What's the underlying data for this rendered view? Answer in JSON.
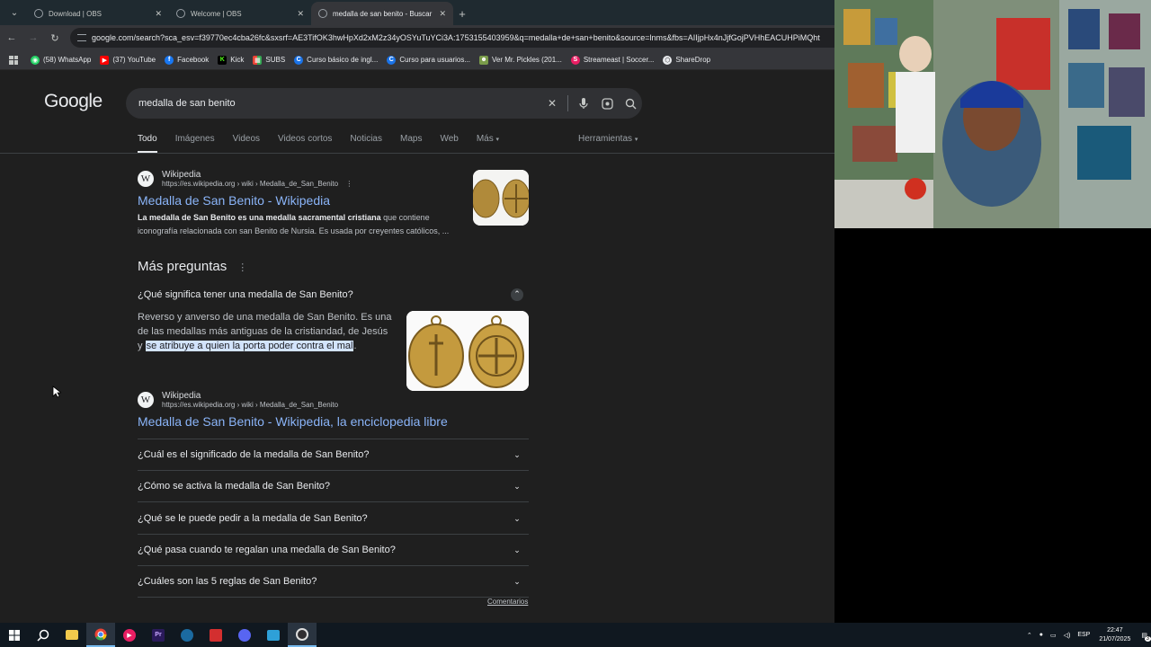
{
  "browser": {
    "tabs": [
      {
        "label": "Download | OBS",
        "active": false
      },
      {
        "label": "Welcome | OBS",
        "active": false
      },
      {
        "label": "medalla de san benito - Buscar",
        "active": true
      }
    ],
    "url": "google.com/search?sca_esv=f39770ec4cba26fc&sxsrf=AE3TifOK3hwHpXd2xM2z34yOSYuTuYCi3A:1753155403959&q=medalla+de+san+benito&source=lnms&fbs=AIIjpHx4nJjfGojPVHhEACUHPiMQht",
    "bookmarks": [
      {
        "label": "(58) WhatsApp",
        "icon": "whatsapp-icon",
        "color": "#25d366"
      },
      {
        "label": "(37) YouTube",
        "icon": "youtube-icon",
        "color": "#ff0000"
      },
      {
        "label": "Facebook",
        "icon": "facebook-icon",
        "color": "#1877f2"
      },
      {
        "label": "Kick",
        "icon": "kick-icon",
        "color": "#53fc18"
      },
      {
        "label": "SUBS",
        "icon": "subs-icon",
        "color": "#e8eaed"
      },
      {
        "label": "Curso básico de ingl...",
        "icon": "course-icon",
        "color": "#1a73e8"
      },
      {
        "label": "Curso para usuarios...",
        "icon": "course-icon",
        "color": "#1a73e8"
      },
      {
        "label": "Ver Mr. Pickles (201...",
        "icon": "pickles-icon",
        "color": "#7a9c4a"
      },
      {
        "label": "Streameast | Soccer...",
        "icon": "streameast-icon",
        "color": "#e91e63"
      },
      {
        "label": "ShareDrop",
        "icon": "sharedrop-icon",
        "color": "#e8eaed"
      }
    ]
  },
  "google": {
    "logo": "Google",
    "query": "medalla de san benito",
    "tabs": [
      "Todo",
      "Imágenes",
      "Videos",
      "Videos cortos",
      "Noticias",
      "Maps",
      "Web",
      "Más"
    ],
    "tools": "Herramientas",
    "result1": {
      "source": "Wikipedia",
      "url": "https://es.wikipedia.org › wiki › Medalla_de_San_Benito",
      "title": "Medalla de San Benito - Wikipedia",
      "snippet_bold": "La medalla de San Benito es una medalla sacramental cristiana",
      "snippet_rest": " que contiene iconografía relacionada con san Benito de Nursia. Es usada por creyentes católicos, ..."
    },
    "paa": {
      "heading": "Más preguntas",
      "expanded_question": "¿Qué significa tener una medalla de San Benito?",
      "answer_plain": "Reverso y anverso de una medalla de San Benito. Es una de las medallas más antiguas de la cristiandad, de Jesús y ",
      "answer_highlight": "se atribuye a quien la porta poder contra el mal",
      "answer_end": ".",
      "answer_source": {
        "source": "Wikipedia",
        "url": "https://es.wikipedia.org › wiki › Medalla_de_San_Benito",
        "title": "Medalla de San Benito - Wikipedia, la enciclopedia libre"
      },
      "questions": [
        "¿Cuál es el significado de la medalla de San Benito?",
        "¿Cómo se activa la medalla de San Benito?",
        "¿Qué se le puede pedir a la medalla de San Benito?",
        "¿Qué pasa cuando te regalan una medalla de San Benito?",
        "¿Cuáles son las 5 reglas de San Benito?"
      ],
      "feedback": "Comentarios"
    }
  },
  "taskbar": {
    "lang": "ESP",
    "time": "22:47",
    "date": "21/07/2025",
    "notif_count": "3"
  }
}
